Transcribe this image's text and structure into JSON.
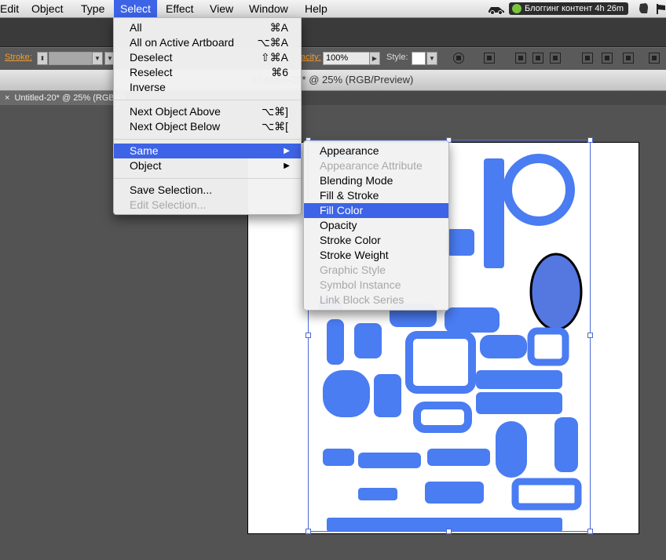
{
  "menubar": {
    "items": [
      "Edit",
      "Object",
      "Type",
      "Select",
      "Effect",
      "View",
      "Window",
      "Help"
    ],
    "active": "Select",
    "timer_text": "Блоггинг контент 4h 26m"
  },
  "control_bar": {
    "stroke_label": "Stroke:",
    "opacity_label": "acity:",
    "opacity_value": "100%",
    "style_label": "Style:"
  },
  "window_title": "Untitled-20* @ 25% (RGB/Preview)",
  "doc_tab": "Untitled-20* @ 25% (RGB/Preview)",
  "select_menu": {
    "items": [
      {
        "label": "All",
        "shortcut": "⌘A"
      },
      {
        "label": "All on Active Artboard",
        "shortcut": "⌥⌘A"
      },
      {
        "label": "Deselect",
        "shortcut": "⇧⌘A"
      },
      {
        "label": "Reselect",
        "shortcut": "⌘6"
      },
      {
        "label": "Inverse",
        "shortcut": ""
      },
      {
        "label": "Next Object Above",
        "shortcut": "⌥⌘]"
      },
      {
        "label": "Next Object Below",
        "shortcut": "⌥⌘["
      },
      {
        "label": "Same",
        "shortcut": "▶"
      },
      {
        "label": "Object",
        "shortcut": "▶"
      },
      {
        "label": "Save Selection...",
        "shortcut": ""
      },
      {
        "label": "Edit Selection...",
        "shortcut": ""
      }
    ]
  },
  "same_submenu": {
    "items": [
      "Appearance",
      "Appearance Attribute",
      "Blending Mode",
      "Fill & Stroke",
      "Fill Color",
      "Opacity",
      "Stroke Color",
      "Stroke Weight",
      "Graphic Style",
      "Symbol Instance",
      "Link Block Series"
    ],
    "highlighted": "Fill Color"
  },
  "colors": {
    "menu_highlight": "#3d63e6",
    "artwork_blue": "#4a7cf2",
    "selection_blue": "#4a6ad8"
  }
}
